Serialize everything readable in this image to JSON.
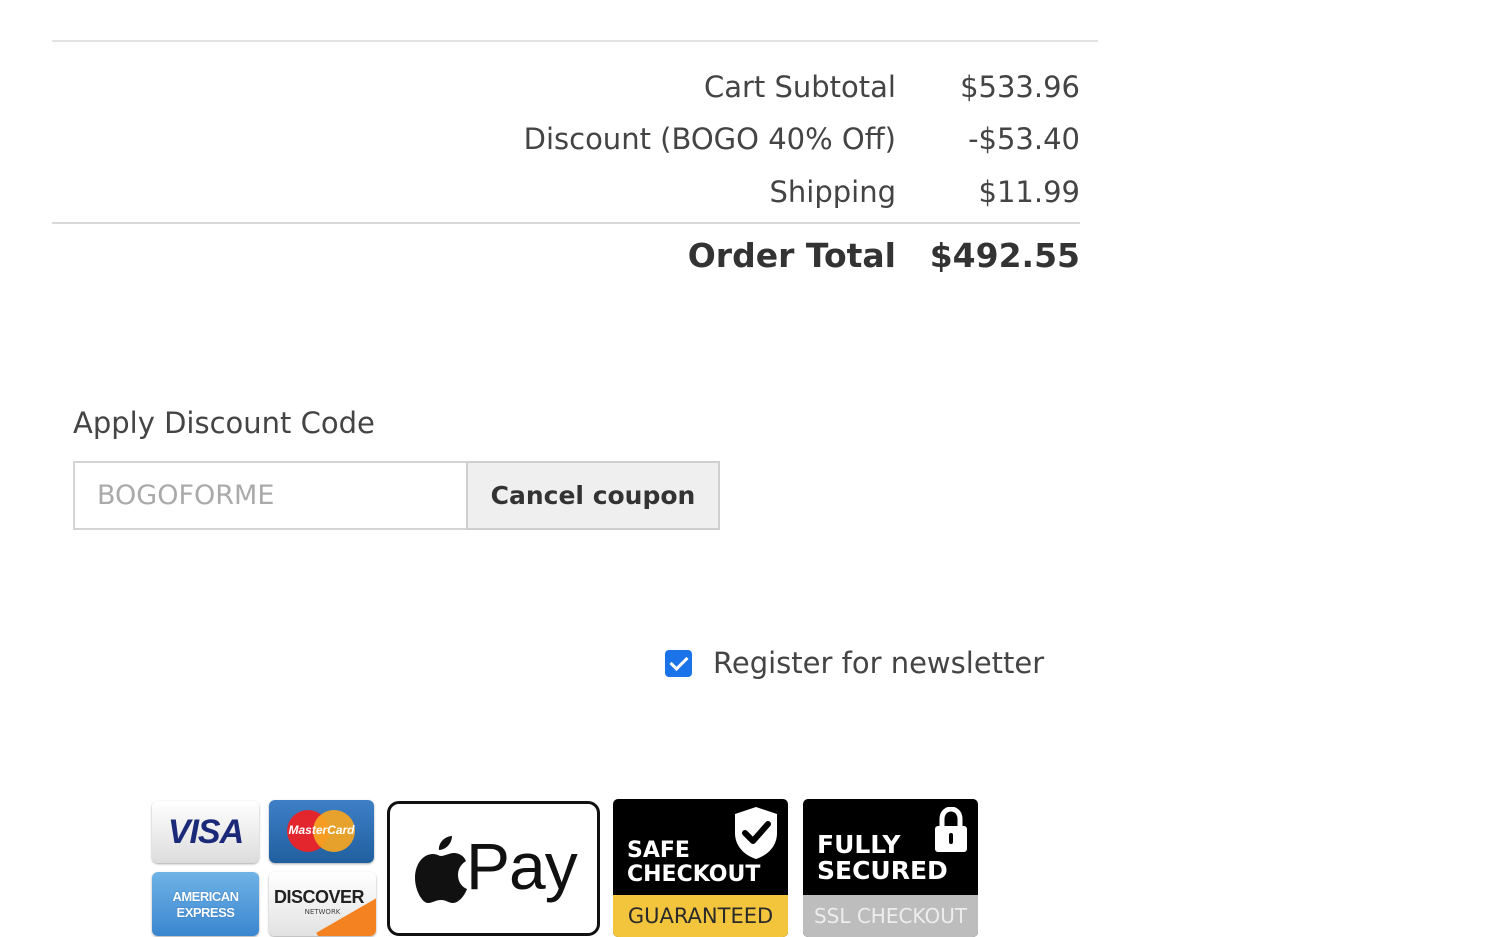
{
  "totals": {
    "subtotal_label": "Cart Subtotal",
    "subtotal_value": "$533.96",
    "discount_label": "Discount (BOGO 40% Off)",
    "discount_value": "-$53.40",
    "shipping_label": "Shipping",
    "shipping_value": "$11.99",
    "order_total_label": "Order Total",
    "order_total_value": "$492.55"
  },
  "discount": {
    "heading": "Apply Discount Code",
    "code_value": "BOGOFORME",
    "cancel_label": "Cancel coupon"
  },
  "newsletter": {
    "label": "Register for newsletter",
    "checked": true,
    "check_color": "#1a73e8"
  },
  "payment_badges": {
    "visa": "VISA",
    "mastercard": "MasterCard",
    "amex_line1": "AMERICAN",
    "amex_line2": "EXPRESS",
    "discover": "DISCOVER",
    "discover_sub": "NETWORK",
    "apple_pay": "Pay",
    "safe_line1": "SAFE",
    "safe_line2": "CHECKOUT",
    "safe_footer": "GUARANTEED",
    "secured_line1": "FULLY",
    "secured_line2": "SECURED",
    "secured_footer": "SSL CHECKOUT",
    "icons": [
      "apple-icon",
      "shield-check-icon",
      "lock-icon"
    ]
  }
}
